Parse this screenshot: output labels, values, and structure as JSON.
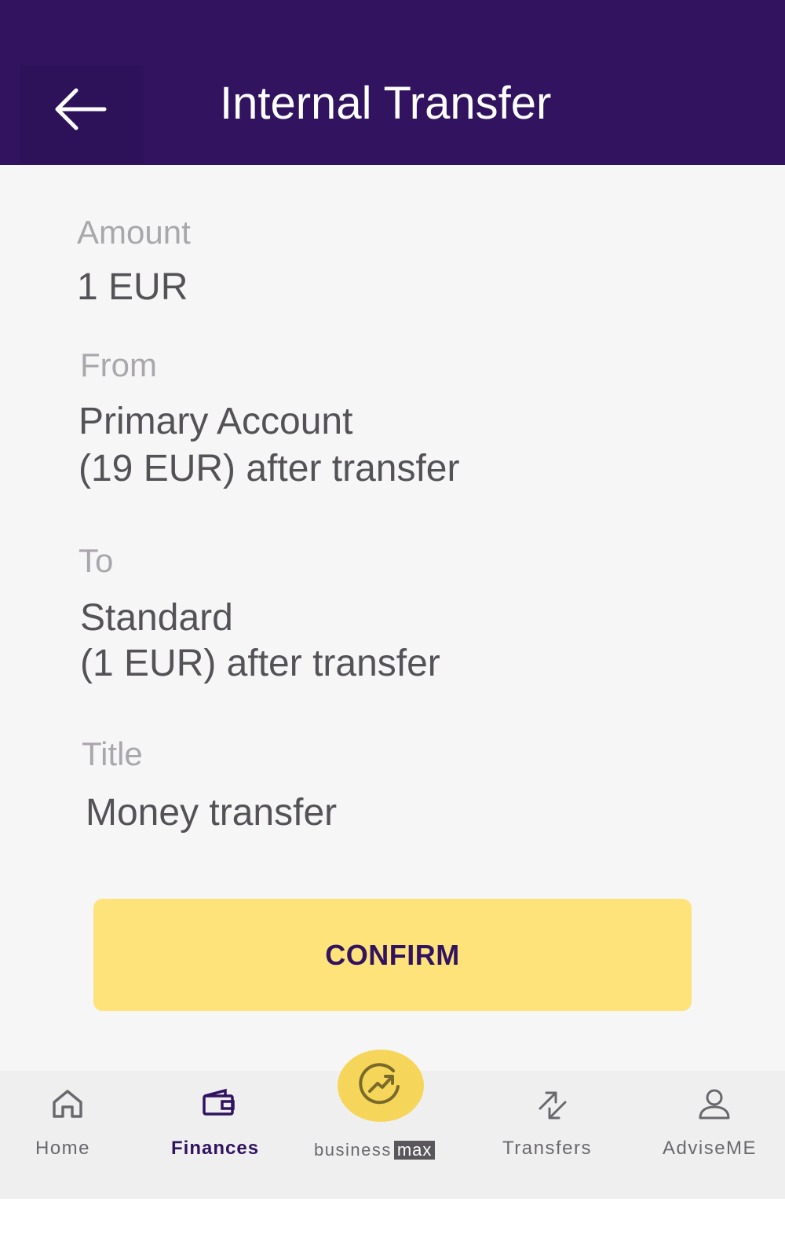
{
  "header": {
    "title": "Internal Transfer",
    "back_icon": "arrow-left-icon"
  },
  "fields": {
    "amount": {
      "label": "Amount",
      "value": "1 EUR"
    },
    "from": {
      "label": "From",
      "account": "Primary Account",
      "balance": "(19 EUR) after transfer"
    },
    "to": {
      "label": "To",
      "account": "Standard",
      "balance": "(1 EUR) after transfer"
    },
    "title": {
      "label": "Title",
      "value": "Money transfer"
    }
  },
  "confirm_label": "CONFIRM",
  "nav": {
    "items": [
      {
        "label": "Home",
        "icon": "home-icon",
        "active": false
      },
      {
        "label": "Finances",
        "icon": "wallet-icon",
        "active": true
      },
      {
        "label": "business",
        "tag": "max",
        "icon": "growth-chart-icon",
        "active": false
      },
      {
        "label": "Transfers",
        "icon": "transfer-arrows-icon",
        "active": false
      },
      {
        "label": "AdviseME",
        "icon": "person-icon",
        "active": false
      }
    ]
  },
  "colors": {
    "header_bg": "#311360",
    "accent_yellow": "#fee27a",
    "active_nav": "#311360"
  }
}
